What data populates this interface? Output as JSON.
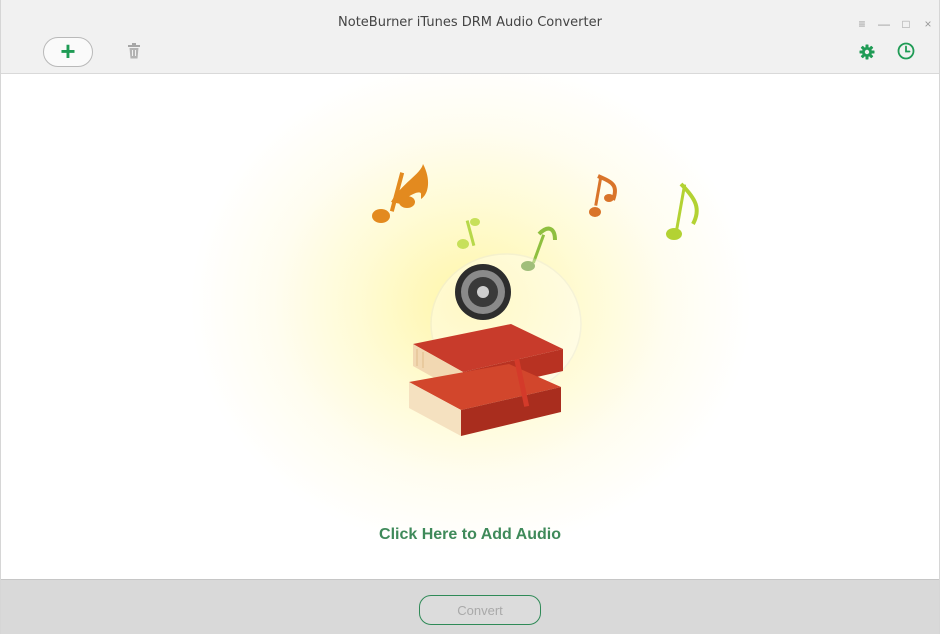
{
  "window": {
    "title": "NoteBurner iTunes DRM Audio Converter",
    "controls": {
      "menu": "≡",
      "minimize": "—",
      "maximize": "□",
      "close": "×"
    }
  },
  "toolbar": {
    "add_label": "+",
    "icons": [
      "plus-icon",
      "trash-icon",
      "gear-icon",
      "clock-icon"
    ],
    "accent_color": "#1f9b55"
  },
  "main": {
    "add_audio_label": "Click Here to Add Audio"
  },
  "footer": {
    "convert_label": "Convert"
  }
}
